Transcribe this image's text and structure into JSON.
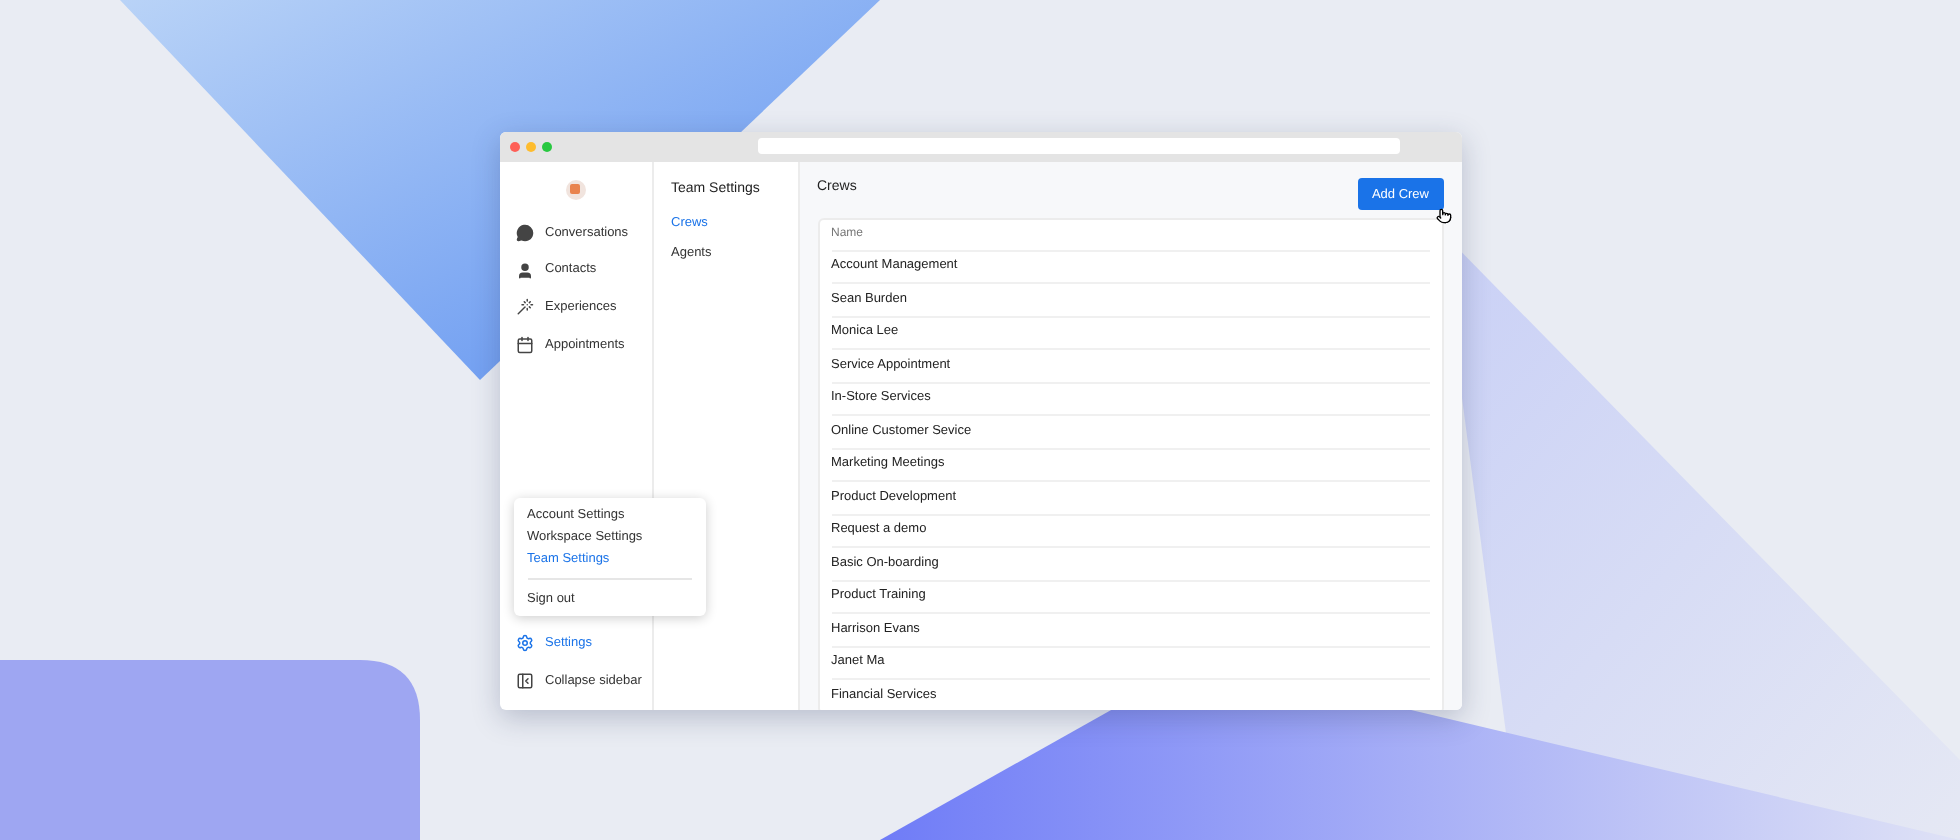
{
  "nav": {
    "items": [
      {
        "label": "Conversations",
        "selected": false
      },
      {
        "label": "Contacts",
        "selected": false
      },
      {
        "label": "Experiences",
        "selected": false
      },
      {
        "label": "Appointments",
        "selected": false
      }
    ],
    "bottom": [
      {
        "label": "Settings",
        "selected": true
      },
      {
        "label": "Collapse sidebar",
        "selected": false
      }
    ]
  },
  "menu": {
    "items": [
      {
        "label": "Account Settings",
        "selected": false
      },
      {
        "label": "Workspace Settings",
        "selected": false
      },
      {
        "label": "Team Settings",
        "selected": true
      }
    ],
    "footer": "Sign out"
  },
  "subnav": {
    "title": "Team Settings",
    "items": [
      {
        "label": "Crews",
        "selected": true
      },
      {
        "label": "Agents",
        "selected": false
      }
    ]
  },
  "main": {
    "title": "Crews",
    "button": "Add Crew",
    "table": {
      "columns": [
        "Name"
      ],
      "rows": [
        "Account Management",
        "Sean Burden",
        "Monica Lee",
        "Service Appointment",
        "In-Store Services",
        "Online Customer Sevice",
        "Marketing Meetings",
        "Product Development",
        "Request a demo",
        "Basic On-boarding",
        "Product Training",
        "Harrison Evans",
        "Janet Ma",
        "Financial Services"
      ]
    }
  }
}
